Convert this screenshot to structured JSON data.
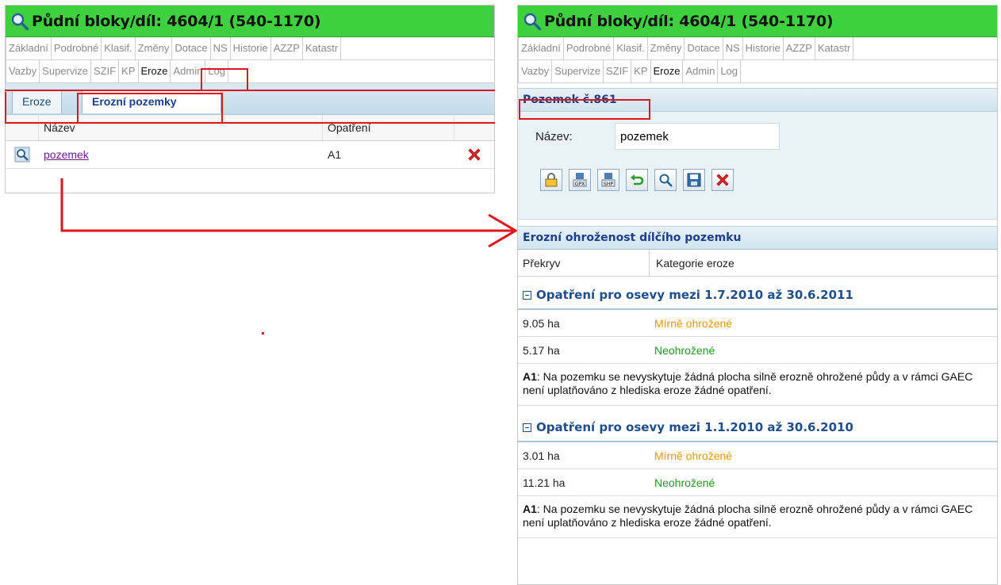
{
  "left": {
    "title": "Půdní bloky/díl: 4604/1 (540-1170)",
    "tabs_row1": [
      "Základní",
      "Podrobné",
      "Klasif.",
      "Změny",
      "Dotace",
      "NS",
      "Historie",
      "AZZP",
      "Katastr"
    ],
    "tabs_row2": [
      "Vazby",
      "Supervize",
      "SZIF",
      "KP",
      "Eroze",
      "Admin",
      "Log"
    ],
    "subtabs": [
      "Eroze",
      "Erozní pozemky"
    ],
    "grid": {
      "columns": [
        "Název",
        "Opatření"
      ],
      "rows": [
        {
          "name": "pozemek",
          "measure": "A1"
        }
      ]
    }
  },
  "right": {
    "title": "Půdní bloky/díl: 4604/1 (540-1170)",
    "tabs_row1": [
      "Základní",
      "Podrobné",
      "Klasif.",
      "Změny",
      "Dotace",
      "NS",
      "Historie",
      "AZZP",
      "Katastr"
    ],
    "tabs_row2": [
      "Vazby",
      "Supervize",
      "SZIF",
      "KP",
      "Eroze",
      "Admin",
      "Log"
    ],
    "plot_header": "Pozemek č.861",
    "name_label": "Název:",
    "name_value": "pozemek",
    "toolbar_icons": [
      "lock-icon",
      "gpx-export-icon",
      "shp-export-icon",
      "undo-icon",
      "zoom-icon",
      "save-icon",
      "delete-icon"
    ],
    "erosion_header": "Erozní ohroženost dílčího pozemku",
    "erosion_columns": [
      "Překryv",
      "Kategorie eroze"
    ],
    "groups": [
      {
        "title": "Opatření pro osevy mezi 1.7.2010 až 30.6.2011",
        "rows": [
          {
            "area": "9.05 ha",
            "category": "Mírně ohrožené",
            "color": "#f29400"
          },
          {
            "area": "5.17 ha",
            "category": "Neohrožené",
            "color": "#1c9a1c"
          }
        ],
        "note_code": "A1",
        "note_text": ": Na pozemku se nevyskytuje žádná plocha silně erozně ohrožené půdy a v rámci GAEC není uplatňováno z hlediska eroze žádné opatření."
      },
      {
        "title": "Opatření pro osevy mezi 1.1.2010 až 30.6.2010",
        "rows": [
          {
            "area": "3.01 ha",
            "category": "Mírně ohrožené",
            "color": "#f29400"
          },
          {
            "area": "11.21 ha",
            "category": "Neohrožené",
            "color": "#1c9a1c"
          }
        ],
        "note_code": "A1",
        "note_text": ": Na pozemku se nevyskytuje žádná plocha silně erozně ohrožené půdy a v rámci GAEC není uplatňováno z hlediska eroze žádné opatření."
      }
    ]
  },
  "colors": {
    "titlebar": "#3fd03f",
    "highlight": "#e0141a",
    "section_text": "#1c3f8c"
  }
}
